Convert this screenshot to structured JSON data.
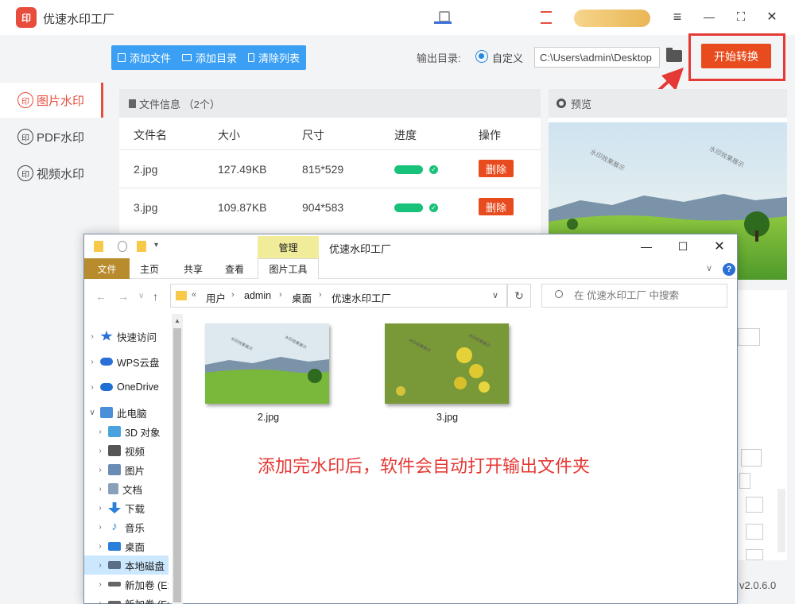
{
  "app": {
    "title": "优速水印工厂",
    "logo_text": "印",
    "version": "v2.0.6.0",
    "window_controls": {
      "menu": "≡",
      "minimize": "—",
      "maximize": "⛶",
      "close": "✕"
    }
  },
  "sidebar": {
    "items": [
      {
        "label": "图片水印",
        "icon": "印",
        "active": true
      },
      {
        "label": "PDF水印",
        "icon": "印",
        "active": false
      },
      {
        "label": "视频水印",
        "icon": "印",
        "active": false
      }
    ]
  },
  "toolbar": {
    "add_file": "添加文件",
    "add_folder": "添加目录",
    "clear_list": "清除列表"
  },
  "output": {
    "label": "输出目录:",
    "option": "自定义",
    "path": "C:\\Users\\admin\\Desktop",
    "start_button": "开始转换"
  },
  "file_list": {
    "header": "文件信息 （2个）",
    "columns": [
      "文件名",
      "大小",
      "尺寸",
      "进度",
      "操作"
    ],
    "rows": [
      {
        "name": "2.jpg",
        "size": "127.49KB",
        "dimensions": "815*529",
        "progress": 1.0,
        "action": "删除"
      },
      {
        "name": "3.jpg",
        "size": "109.87KB",
        "dimensions": "904*583",
        "progress": 1.0,
        "action": "删除"
      }
    ]
  },
  "preview": {
    "header": "预览",
    "watermark_text": "水印效果展示"
  },
  "explorer": {
    "title": "优速水印工厂",
    "manage_tab": "管理",
    "ribbon_tabs": [
      "文件",
      "主页",
      "共享",
      "查看",
      "图片工具"
    ],
    "breadcrumb": [
      "用户",
      "admin",
      "桌面",
      "优速水印工厂"
    ],
    "breadcrumb_prefix": "«",
    "search_placeholder": "在 优速水印工厂 中搜索",
    "tree": [
      {
        "label": "快速访问",
        "icon": "star-icon",
        "color": "#2a6fd6",
        "level": 0
      },
      {
        "label": "WPS云盘",
        "icon": "cloud-icon",
        "color": "#2a6fd6",
        "level": 0
      },
      {
        "label": "OneDrive",
        "icon": "cloud-icon",
        "color": "#1e6fd1",
        "level": 0
      },
      {
        "label": "此电脑",
        "icon": "computer-icon",
        "color": "#4a90d9",
        "level": 0
      },
      {
        "label": "3D 对象",
        "icon": "cube-icon",
        "color": "#4aa3df",
        "level": 1
      },
      {
        "label": "视频",
        "icon": "film-icon",
        "color": "#555555",
        "level": 1
      },
      {
        "label": "图片",
        "icon": "picture-icon",
        "color": "#6b8cb5",
        "level": 1
      },
      {
        "label": "文档",
        "icon": "document-icon",
        "color": "#8aa0b8",
        "level": 1
      },
      {
        "label": "下载",
        "icon": "download-icon",
        "color": "#2a7fd8",
        "level": 1
      },
      {
        "label": "音乐",
        "icon": "music-icon",
        "color": "#2a7fd8",
        "level": 1
      },
      {
        "label": "桌面",
        "icon": "desktop-icon",
        "color": "#2a7fd8",
        "level": 1
      },
      {
        "label": "本地磁盘",
        "icon": "disk-icon",
        "color": "#5a6f85",
        "level": 1,
        "selected": true
      },
      {
        "label": "新加卷 (E:",
        "icon": "drive-icon",
        "color": "#666666",
        "level": 1
      },
      {
        "label": "新加卷 (F:",
        "icon": "drive-icon",
        "color": "#666666",
        "level": 1
      }
    ],
    "files": [
      {
        "name": "2.jpg"
      },
      {
        "name": "3.jpg"
      }
    ],
    "note": "添加完水印后，软件会自动打开输出文件夹"
  },
  "colors": {
    "accent_red": "#e84c1e",
    "toolbar_blue": "#3ba0f3",
    "progress_green": "#19c27a",
    "annotation_red": "#e53935"
  }
}
